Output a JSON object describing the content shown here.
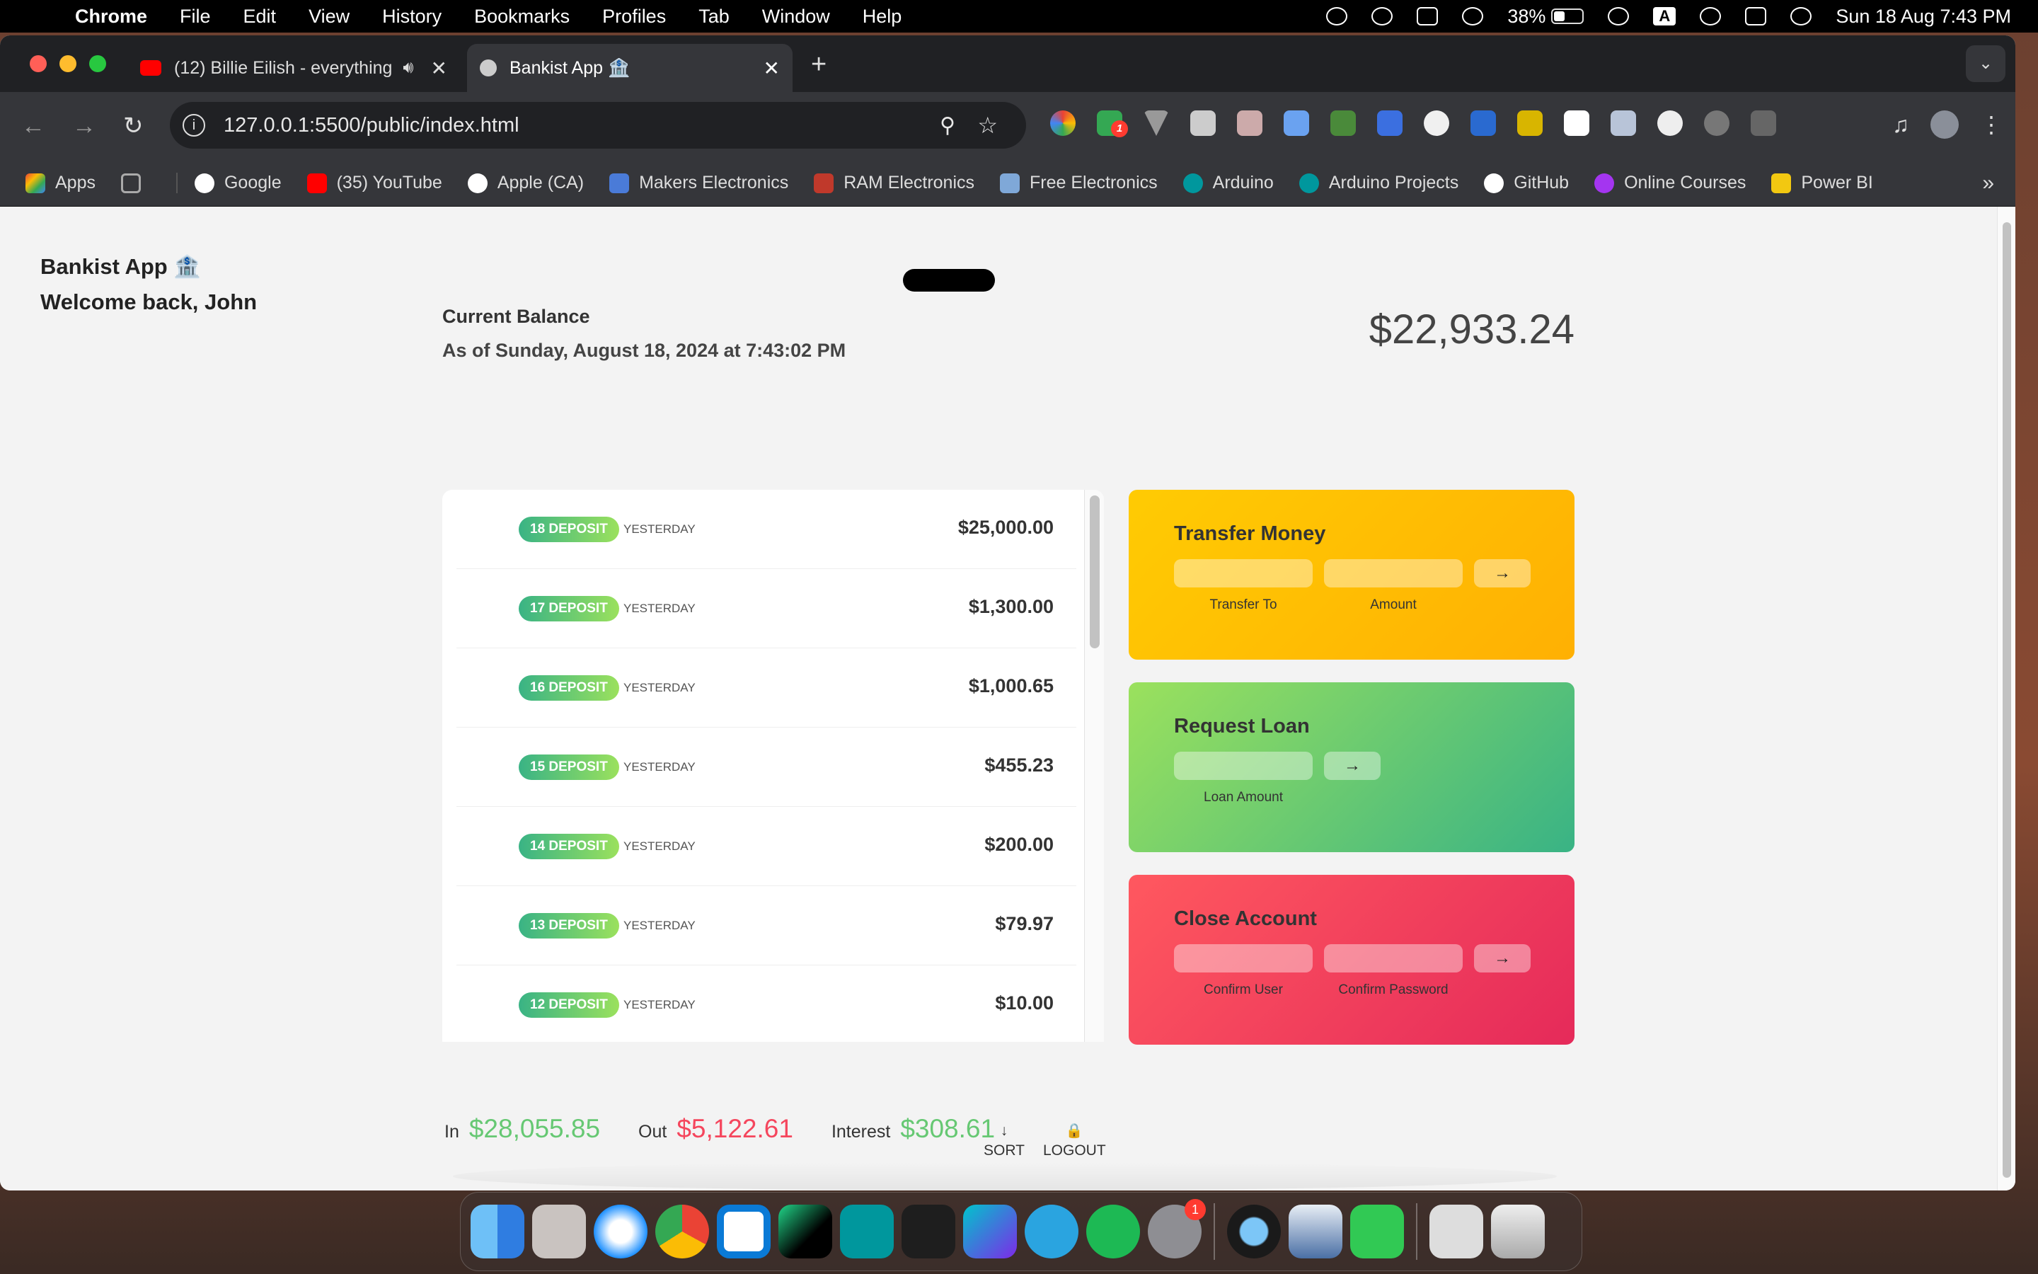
{
  "menubar": {
    "app": "Chrome",
    "items": [
      "File",
      "Edit",
      "View",
      "History",
      "Bookmarks",
      "Profiles",
      "Tab",
      "Window",
      "Help"
    ],
    "battery_percent": "38%",
    "battery_level": 0.38,
    "input_source": "A",
    "clock": "Sun 18 Aug  7:43 PM"
  },
  "browser": {
    "tabs": [
      {
        "title": "(12) Billie Eilish - everything",
        "favicon_color": "#ff0000"
      },
      {
        "title": "Bankist App 🏦",
        "favicon_color": "#cccccc"
      }
    ],
    "new_tab": "+",
    "url": "127.0.0.1:5500/public/index.html",
    "bookmarks": [
      {
        "label": "Apps",
        "color": "#e94235"
      },
      {
        "label": "",
        "color": "#aaaaaa"
      },
      {
        "label": "Google",
        "color": "#ffffff"
      },
      {
        "label": "(35) YouTube",
        "color": "#ff0000"
      },
      {
        "label": "Apple (CA)",
        "color": "#ffffff"
      },
      {
        "label": "Makers Electronics",
        "color": "#4a7bd8"
      },
      {
        "label": "RAM Electronics",
        "color": "#c0392b"
      },
      {
        "label": "Free Electronics",
        "color": "#7fa8d8"
      },
      {
        "label": "Arduino",
        "color": "#00979d"
      },
      {
        "label": "Arduino Projects",
        "color": "#00979d"
      },
      {
        "label": "GitHub",
        "color": "#ffffff"
      },
      {
        "label": "Online Courses",
        "color": "#a435f0"
      },
      {
        "label": "Power BI",
        "color": "#f2c811"
      }
    ],
    "bookmarks_overflow": "»"
  },
  "app": {
    "title": "Bankist App 🏦",
    "welcome": "Welcome back, John",
    "balance_label": "Current Balance",
    "balance_date": "As of Sunday, August 18, 2024 at 7:43:02 PM",
    "balance_value": "$22,933.24",
    "movements": [
      {
        "type": "18 DEPOSIT",
        "date": "YESTERDAY",
        "value": "$25,000.00"
      },
      {
        "type": "17 DEPOSIT",
        "date": "YESTERDAY",
        "value": "$1,300.00"
      },
      {
        "type": "16 DEPOSIT",
        "date": "YESTERDAY",
        "value": "$1,000.65"
      },
      {
        "type": "15 DEPOSIT",
        "date": "YESTERDAY",
        "value": "$455.23"
      },
      {
        "type": "14 DEPOSIT",
        "date": "YESTERDAY",
        "value": "$200.00"
      },
      {
        "type": "13 DEPOSIT",
        "date": "YESTERDAY",
        "value": "$79.97"
      },
      {
        "type": "12 DEPOSIT",
        "date": "YESTERDAY",
        "value": "$10.00"
      }
    ],
    "transfer": {
      "title": "Transfer Money",
      "to_label": "Transfer To",
      "amount_label": "Amount",
      "button": "→"
    },
    "loan": {
      "title": "Request Loan",
      "amount_label": "Loan Amount",
      "button": "→"
    },
    "close": {
      "title": "Close Account",
      "user_label": "Confirm User",
      "pin_label": "Confirm Password",
      "button": "→"
    },
    "summary": {
      "in_label": "In",
      "in_value": "$28,055.85",
      "out_label": "Out",
      "out_value": "$5,122.61",
      "interest_label": "Interest",
      "interest_value": "$308.61"
    },
    "sort": {
      "icon": "↓",
      "label": "SORT"
    },
    "logout": {
      "icon": "🔒",
      "label": "LOGOUT"
    }
  },
  "dock": {
    "apps": [
      "finder",
      "launchpad",
      "safari",
      "chrome",
      "vscode",
      "clion",
      "arduino",
      "figma",
      "canva",
      "telegram",
      "spotify",
      "system-settings",
      "quicktime",
      "preview",
      "facetime",
      "user-folder",
      "trash"
    ],
    "settings_badge": "1"
  },
  "extensions": {
    "badge": "1"
  }
}
